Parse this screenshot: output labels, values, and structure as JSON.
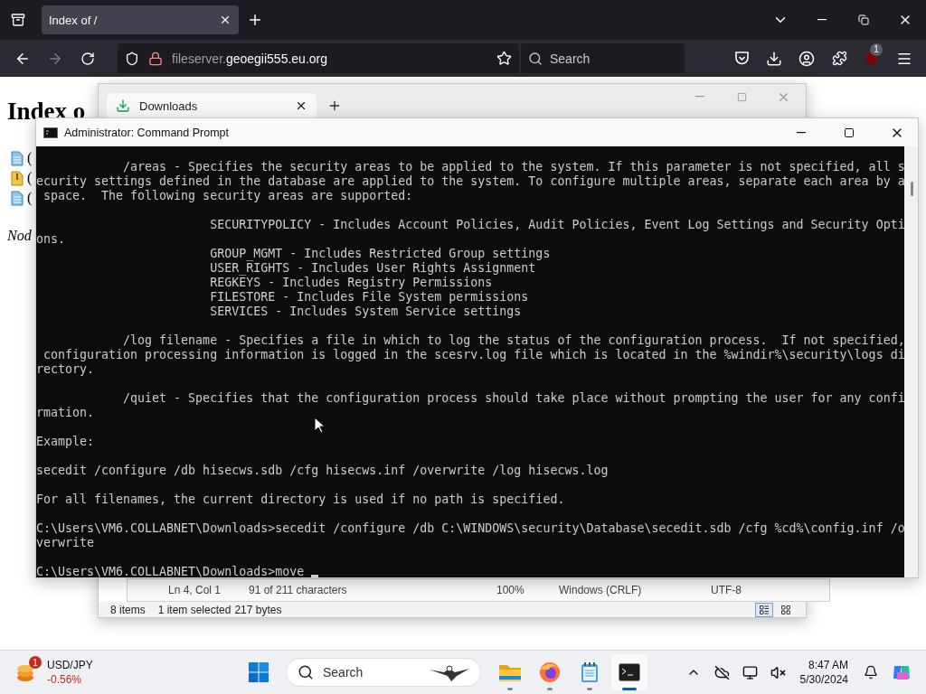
{
  "browser": {
    "tabs": [
      {
        "title": "Index of /",
        "selected": true
      }
    ],
    "url": {
      "subdomain": "fileserver.",
      "domain": "geoegii555.eu.org"
    },
    "search": {
      "placeholder": "Search"
    },
    "extension_badge": "1"
  },
  "page": {
    "heading": "Index o",
    "files": [
      {
        "kind": "document",
        "label": "("
      },
      {
        "kind": "archive",
        "label": "("
      },
      {
        "kind": "document",
        "label": "("
      }
    ],
    "footer": "Nod"
  },
  "explorer": {
    "tabs": [
      {
        "title": "Downloads",
        "selected": true
      }
    ],
    "status": {
      "items": "8 items",
      "selection": "1 item selected",
      "size": "217 bytes"
    },
    "views": [
      {
        "kind": "details",
        "selected": true
      },
      {
        "kind": "tiles",
        "selected": false
      }
    ]
  },
  "notepad": {
    "status": [
      "Ln 4, Col 1",
      "91 of 211 characters",
      "100%",
      "Windows (CRLF)",
      "UTF-8"
    ]
  },
  "cmd": {
    "title": "Administrator: Command Prompt",
    "blocks": [
      [
        "            /areas - Specifies the security areas to be applied to the system. If this parameter is not specified, all s",
        "ecurity settings defined in the database are applied to the system. To configure multiple areas, separate each area by a",
        " space.  The following security areas are supported:"
      ],
      [
        "                        SECURITYPOLICY - Includes Account Policies, Audit Policies, Event Log Settings and Security Opti",
        "ons.",
        "                        GROUP_MGMT - Includes Restricted Group settings",
        "                        USER_RIGHTS - Includes User Rights Assignment",
        "                        REGKEYS - Includes Registry Permissions",
        "                        FILESTORE - Includes File System permissions",
        "                        SERVICES - Includes System Service settings"
      ],
      [
        "            /log filename - Specifies a file in which to log the status of the configuration process.  If not specified,",
        " configuration processing information is logged in the scesrv.log file which is located in the %windir%\\security\\logs di",
        "rectory."
      ],
      [
        "            /quiet - Specifies that the configuration process should take place without prompting the user for any confi",
        "rmation."
      ],
      [
        "Example:"
      ],
      [
        "secedit /configure /db hisecws.sdb /cfg hisecws.inf /overwrite /log hisecws.log"
      ],
      [
        "For all filenames, the current directory is used if no path is specified."
      ],
      [
        "C:\\Users\\VM6.COLLABNET\\Downloads>secedit /configure /db C:\\WINDOWS\\security\\Database\\secedit.sdb /cfg %cd%\\config.inf /o",
        "verwrite"
      ]
    ],
    "prompt": "C:\\Users\\VM6.COLLABNET\\Downloads>move"
  },
  "taskbar": {
    "widget": {
      "badge": "1",
      "title": "USD/JPY",
      "change": "-0.56%"
    },
    "search": {
      "placeholder": "Search"
    },
    "apps": [
      {
        "kind": "folder",
        "selected": false
      },
      {
        "kind": "browser",
        "selected": false
      },
      {
        "kind": "notepad",
        "selected": false
      },
      {
        "kind": "terminal",
        "selected": true
      }
    ],
    "clock": {
      "time": "8:47 AM",
      "date": "5/30/2024"
    }
  }
}
